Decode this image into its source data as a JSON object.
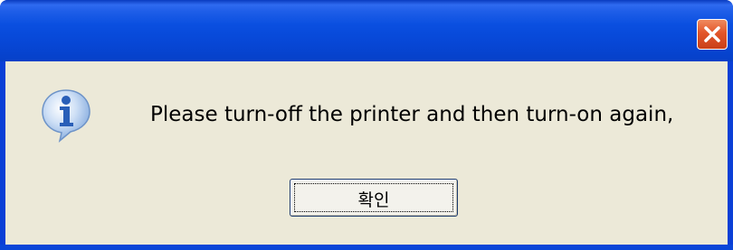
{
  "dialog": {
    "title": "",
    "message": "Please turn-off the printer and then turn-on again,",
    "ok_label": "확인",
    "icon": "info-icon",
    "close_icon": "close-icon"
  },
  "colors": {
    "titlebar_blue": "#0a4fe0",
    "client_bg": "#ece9d8",
    "close_red": "#e2562a",
    "icon_blue": "#3a7ad8"
  }
}
